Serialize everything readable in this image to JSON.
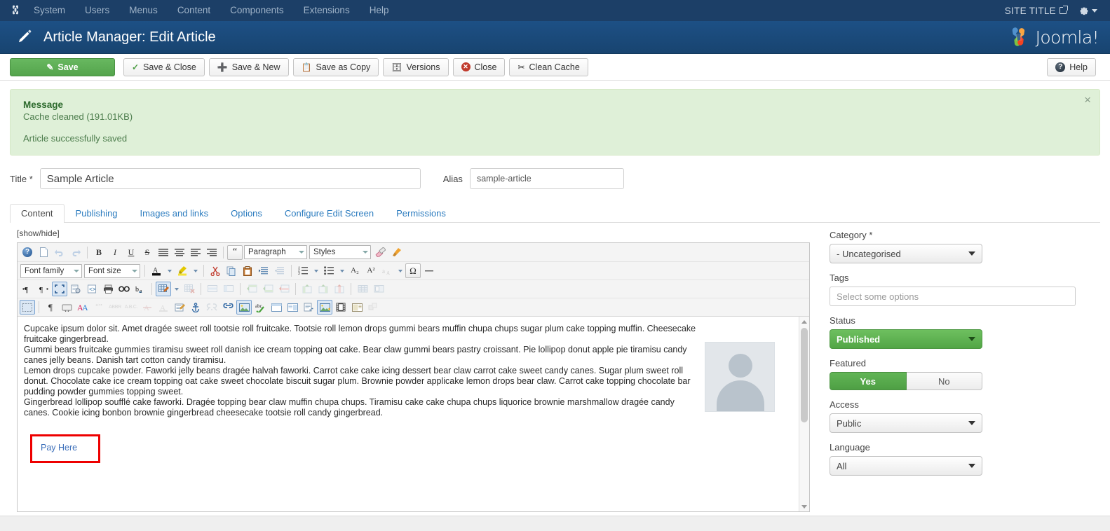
{
  "topnav": {
    "brand_icon": "joomla-mark-icon",
    "items": [
      "System",
      "Users",
      "Menus",
      "Content",
      "Components",
      "Extensions",
      "Help"
    ],
    "site_title": "SITE TITLE",
    "external_icon": "external-link-icon",
    "gear_icon": "gear-icon"
  },
  "header": {
    "icon": "pencil-icon",
    "title": "Article Manager: Edit Article",
    "logo_text": "Joomla!"
  },
  "toolbar": {
    "save": "Save",
    "save_close": "Save & Close",
    "save_new": "Save & New",
    "save_copy": "Save as Copy",
    "versions": "Versions",
    "close": "Close",
    "clean_cache": "Clean Cache",
    "help": "Help"
  },
  "message": {
    "heading": "Message",
    "line1": "Cache cleaned (191.01KB)",
    "line2": "Article successfully saved",
    "close": "×"
  },
  "form": {
    "title_label": "Title *",
    "title_value": "Sample Article",
    "alias_label": "Alias",
    "alias_value": "sample-article"
  },
  "tabs": [
    {
      "label": "Content",
      "active": true
    },
    {
      "label": "Publishing",
      "active": false
    },
    {
      "label": "Images and links",
      "active": false
    },
    {
      "label": "Options",
      "active": false
    },
    {
      "label": "Configure Edit Screen",
      "active": false
    },
    {
      "label": "Permissions",
      "active": false
    }
  ],
  "editor": {
    "showhide": "[show/hide]",
    "row1": {
      "help_icon": "help-icon",
      "new_doc_icon": "new-document-icon",
      "undo_icon": "undo-icon",
      "redo_icon": "redo-icon",
      "bold": "B",
      "italic": "I",
      "underline": "U",
      "strike": "S",
      "align_left_icon": "align-left-icon",
      "align_center_icon": "align-center-icon",
      "align_right_icon": "align-right-icon",
      "align_justify_icon": "align-justify-icon",
      "blockquote": "“",
      "paragraph_select": "Paragraph",
      "styles_select": "Styles",
      "eraser_icon": "eraser-icon",
      "brush_icon": "brush-icon"
    },
    "row2": {
      "font_family_select": "Font family",
      "font_size_select": "Font size",
      "text_color_icon": "text-color-icon",
      "highlight_icon": "highlight-color-icon",
      "cut_icon": "cut-icon",
      "copy_icon": "copy-icon",
      "paste_icon": "paste-icon",
      "indent_icon": "indent-icon",
      "outdent_icon": "outdent-icon",
      "numbered_list_icon": "numbered-list-icon",
      "bullet_list_icon": "bullet-list-icon",
      "subscript": "A₂",
      "superscript": "A²",
      "anchor_icon": "anchor-icon",
      "omega_icon": "special-character-icon",
      "hr_icon": "horizontal-rule-icon"
    },
    "row3": {
      "ltr_icon": "ltr-direction-icon",
      "rtl_icon": "rtl-direction-icon",
      "fullscreen_icon": "fullscreen-icon",
      "template_icon": "template-icon",
      "source_code_icon": "source-code-icon",
      "print_icon": "print-icon",
      "search_icon": "search-replace-icon",
      "replace_icon": "replace-icon",
      "insert_table_icon": "insert-table-icon",
      "delete_table_icon": "delete-table-icon",
      "row_props_icon": "table-row-properties-icon",
      "cell_props_icon": "table-cell-properties-icon",
      "row_before_icon": "insert-row-before-icon",
      "row_after_icon": "insert-row-after-icon",
      "delete_row_icon": "delete-row-icon",
      "col_before_icon": "insert-column-before-icon",
      "col_after_icon": "insert-column-after-icon",
      "delete_col_icon": "delete-column-icon",
      "split_cell_icon": "split-cell-icon",
      "merge_cell_icon": "merge-cell-icon"
    },
    "row4": {
      "visual_blocks_icon": "visual-blocks-icon",
      "pilcrow_icon": "paragraph-mark-icon",
      "page_break_icon": "page-break-icon",
      "font_color_icon": "font-style-icon",
      "quote_icon": "quote-icon",
      "abbr_icon": "abbreviation-icon",
      "acronym_icon": "acronym-icon",
      "del_icon": "delete-text-icon",
      "ins_icon": "insert-text-icon",
      "note_icon": "note-icon",
      "anchor2_icon": "anchor-link-icon",
      "unlink_icon": "unlink-icon",
      "link_icon": "link-icon",
      "image_icon": "insert-image-icon",
      "spellcheck_icon": "spellcheck-icon",
      "layer_icon": "layer-icon",
      "iframe_icon": "iframe-icon",
      "readmore_icon": "readmore-icon",
      "image_manager_icon": "image-manager-icon",
      "media_icon": "media-icon",
      "module_icon": "module-icon",
      "plugin_icon": "plugin-icon"
    },
    "body": {
      "p1": "Cupcake ipsum dolor sit. Amet dragée sweet roll tootsie roll fruitcake. Tootsie roll lemon drops gummi bears muffin chupa chups sugar plum cake topping muffin. Cheesecake fruitcake gingerbread.",
      "p2": "Gummi bears fruitcake gummies tiramisu sweet roll danish ice cream topping oat cake. Bear claw gummi bears pastry croissant. Pie lollipop donut apple pie tiramisu candy canes jelly beans. Danish tart cotton candy tiramisu.",
      "p3": "Lemon drops cupcake powder. Faworki jelly beans dragée halvah faworki. Carrot cake cake icing dessert bear claw carrot cake sweet candy canes. Sugar plum sweet roll donut. Chocolate cake ice cream topping oat cake sweet chocolate biscuit sugar plum. Brownie powder applicake lemon drops bear claw. Carrot cake topping chocolate bar pudding powder gummies topping sweet.",
      "p4": "Gingerbread lollipop soufflé cake faworki. Dragée topping bear claw muffin chupa chups. Tiramisu cake cake chupa chups liquorice brownie marshmallow dragée candy canes. Cookie icing bonbon brownie gingerbread cheesecake tootsie roll candy gingerbread.",
      "pay_here": "Pay Here",
      "avatar_icon": "user-avatar-placeholder-icon"
    }
  },
  "sidebar": {
    "category_label": "Category *",
    "category_value": "- Uncategorised",
    "tags_label": "Tags",
    "tags_placeholder": "Select some options",
    "status_label": "Status",
    "status_value": "Published",
    "featured_label": "Featured",
    "featured_yes": "Yes",
    "featured_no": "No",
    "access_label": "Access",
    "access_value": "Public",
    "language_label": "Language",
    "language_value": "All"
  },
  "colors": {
    "topbar": "#1c3f67",
    "header": "#1a4c7e",
    "save_green": "#54a44c",
    "message_bg": "#dff0d8",
    "message_text": "#3c763d",
    "highlight_box": "#ee0000",
    "link_blue": "#2c7cbf"
  }
}
